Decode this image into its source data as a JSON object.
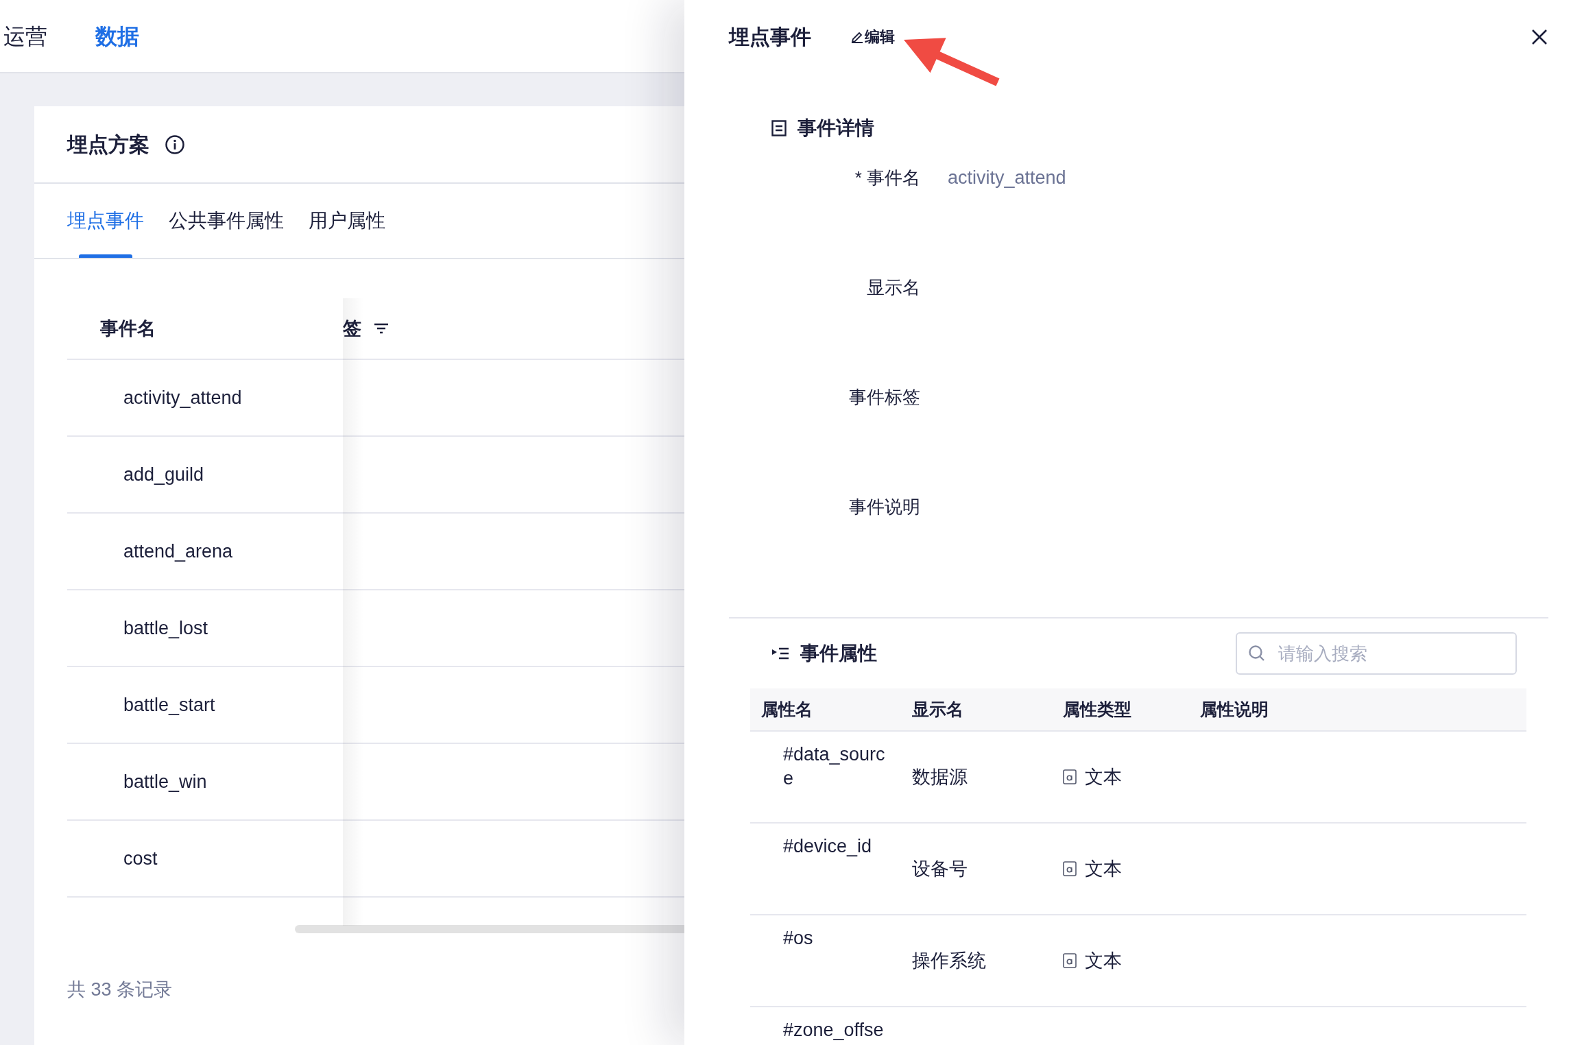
{
  "top_nav": {
    "tabs": [
      {
        "label": "运营",
        "selected": false
      },
      {
        "label": "数据",
        "selected": true
      }
    ]
  },
  "card": {
    "title": "埋点方案",
    "tabs": [
      {
        "label": "埋点事件",
        "selected": true
      },
      {
        "label": "公共事件属性",
        "selected": false
      },
      {
        "label": "用户属性",
        "selected": false
      }
    ],
    "table": {
      "columns": [
        "事件名",
        "签"
      ],
      "rows": [
        {
          "name": "activity_attend"
        },
        {
          "name": "add_guild"
        },
        {
          "name": "attend_arena"
        },
        {
          "name": "battle_lost"
        },
        {
          "name": "battle_start"
        },
        {
          "name": "battle_win"
        },
        {
          "name": "cost"
        }
      ]
    },
    "footer": "共 33 条记录"
  },
  "drawer": {
    "title": "埋点事件",
    "edit_label": "编辑",
    "details": {
      "title": "事件详情",
      "fields": [
        {
          "label": "* 事件名",
          "value": "activity_attend"
        },
        {
          "label": "显示名"
        },
        {
          "label": "事件标签"
        },
        {
          "label": "事件说明"
        }
      ]
    },
    "attributes": {
      "title": "事件属性",
      "search": {
        "placeholder": "请输入搜索"
      },
      "columns": [
        "属性名",
        "显示名",
        "属性类型",
        "属性说明"
      ],
      "rows": [
        {
          "name": "#data_source",
          "display_name": "数据源",
          "kind": "text",
          "type": "文本"
        },
        {
          "name": "#device_id",
          "display_name": "设备号",
          "kind": "text",
          "type": "文本"
        },
        {
          "name": "#os",
          "display_name": "操作系统",
          "kind": "text",
          "type": "文本"
        },
        {
          "name": "#zone_offse"
        }
      ]
    }
  }
}
